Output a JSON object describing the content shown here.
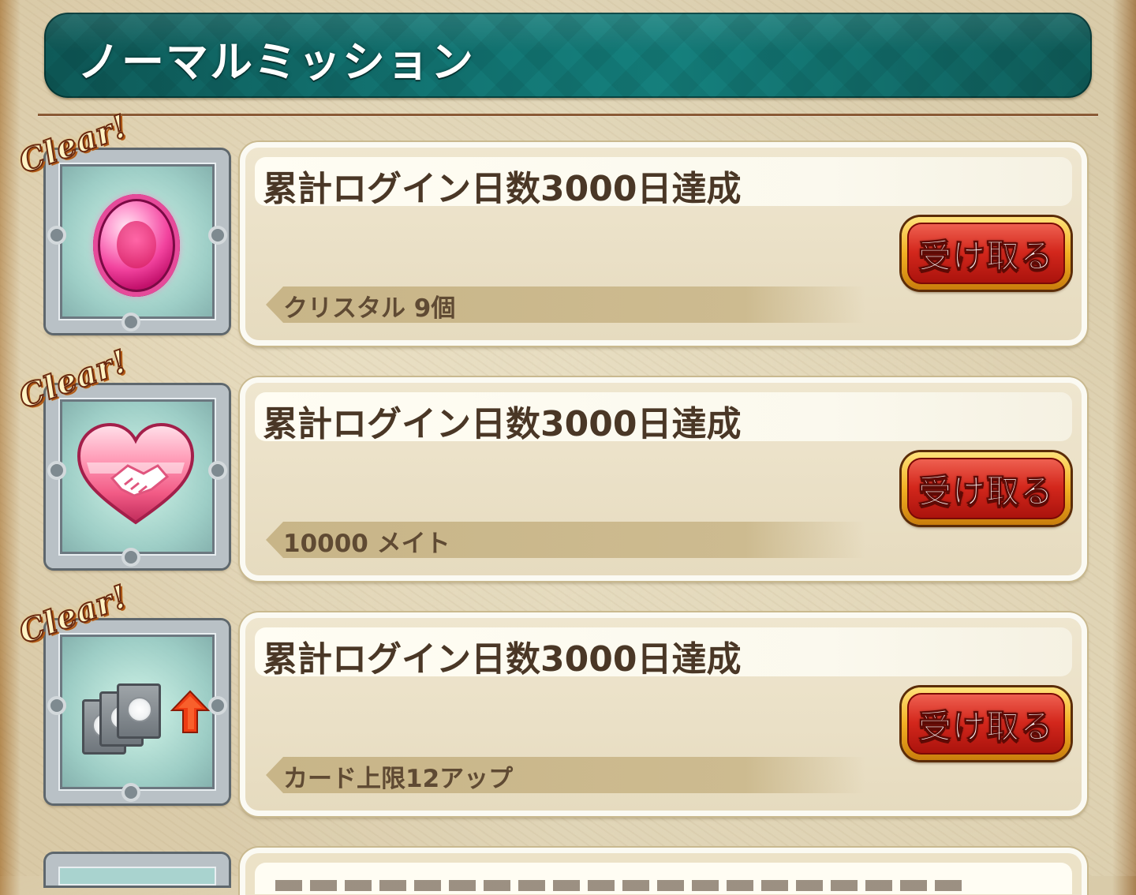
{
  "header": {
    "title": "ノーマルミッション"
  },
  "missions": [
    {
      "badge": "Clear!",
      "title": "累計ログイン日数3000日達成",
      "reward": "クリスタル 9個",
      "button_label": "受け取る",
      "icon": "crystal-gem-icon"
    },
    {
      "badge": "Clear!",
      "title": "累計ログイン日数3000日達成",
      "reward": "10000 メイト",
      "button_label": "受け取る",
      "icon": "friendship-heart-icon"
    },
    {
      "badge": "Clear!",
      "title": "累計ログイン日数3000日達成",
      "reward": "カード上限12アップ",
      "button_label": "受け取る",
      "icon": "card-limit-up-icon"
    }
  ],
  "colors": {
    "header_teal": "#127472",
    "button_red": "#d3271c",
    "button_gold": "#f2b024",
    "title_text": "#4a3726",
    "panel_bg": "#e6dbbf"
  }
}
